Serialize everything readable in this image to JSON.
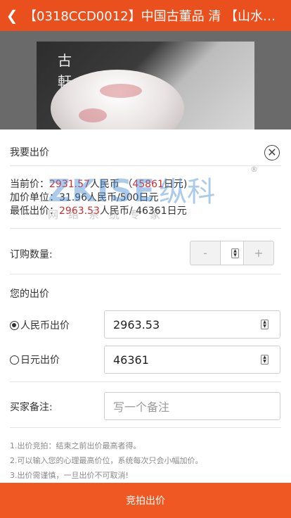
{
  "header": {
    "back_icon": "chevron-left-icon",
    "title": "【0318CCD0012】中国古董品 清 【山水…"
  },
  "product": {
    "logo_text": "古\n軒"
  },
  "dialog": {
    "heading": "我要出价",
    "close_icon": "close-circle-icon",
    "current_price_label": "当前价：",
    "current_price_rmb": "2931.57",
    "rmb_unit": "人民币",
    "current_price_jpy_open": "（",
    "current_price_jpy": "45861",
    "jpy_unit_close": "日元)",
    "increment_line": "加价单位：31.96人民币/500日元",
    "min_bid_label": "最低出价：",
    "min_bid_rmb": "2963.53",
    "min_bid_rest": "人民币/ 46361日元",
    "quantity_label": "订购数量:",
    "quantity_minus": "-",
    "quantity_plus": "+",
    "quantity_value": "",
    "your_bid_label": "您的出价",
    "rmb_option_label": "人民币出价",
    "rmb_bid_value": "2963.53",
    "jpy_option_label": "日元出价",
    "jpy_bid_value": "46361",
    "remark_label": "买家备注:",
    "remark_placeholder": "写一个备注",
    "notes": [
      "1.出价竞拍：结束之前出价最高者得。",
      "2.可以输入您的心理最高价位，系统每次只会小幅加价。",
      "3.出价需谨慎，一旦出价不可取消!"
    ],
    "submit_label": "竞拍出价"
  },
  "watermark": {
    "main": "ZKISE",
    "cn": "纵科",
    "sub": "网络系统专家",
    "reg": "®"
  },
  "colors": {
    "accent": "#ef5723",
    "price_red": "#d42b2b",
    "header": "#e9501e"
  }
}
